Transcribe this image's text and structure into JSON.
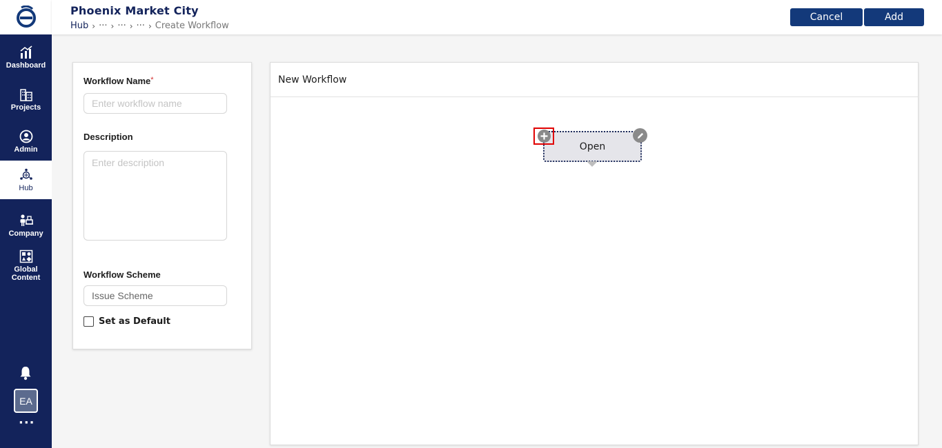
{
  "app": {
    "title": "Phoenix Market City"
  },
  "breadcrumb": {
    "root": "Hub",
    "ellipsis": [
      "···",
      "···",
      "···"
    ],
    "current": "Create Workflow"
  },
  "actions": {
    "cancel_label": "Cancel",
    "add_label": "Add"
  },
  "sidebar": {
    "items": [
      {
        "label": "Dashboard",
        "icon": "chart-icon"
      },
      {
        "label": "Projects",
        "icon": "buildings-icon"
      },
      {
        "label": "Admin",
        "icon": "admin-user-icon"
      },
      {
        "label": "Hub",
        "icon": "hub-icon",
        "active": true
      },
      {
        "label": "Company",
        "icon": "company-icon"
      },
      {
        "label": "Global Content",
        "icon": "global-content-icon"
      }
    ],
    "avatar_initials": "EA",
    "more_label": "···"
  },
  "form": {
    "workflow_name_label": "Workflow Name",
    "required_mark": "*",
    "workflow_name_placeholder": "Enter workflow name",
    "workflow_name_value": "",
    "description_label": "Description",
    "description_placeholder": "Enter description",
    "scheme_label": "Workflow Scheme",
    "scheme_value": "Issue Scheme",
    "default_checkbox_label": "Set as Default",
    "default_checked": false
  },
  "workflow": {
    "title": "New Workflow",
    "node_label": "Open"
  },
  "colors": {
    "sidebar_bg": "#13235b",
    "primary_button": "#13397a",
    "highlight_border": "#e00000",
    "node_bg": "#e5e5ea"
  }
}
